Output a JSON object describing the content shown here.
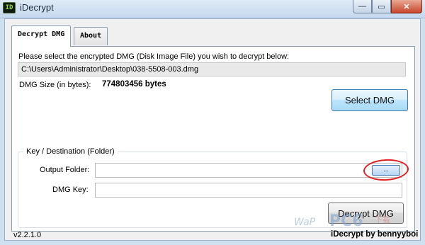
{
  "window": {
    "title": "iDecrypt",
    "icon": "app-icon",
    "icon_glyph": "ID",
    "controls": {
      "minimize": "—",
      "maximize": "▭",
      "close": "✕"
    }
  },
  "tabs": [
    {
      "label": "Decrypt DMG",
      "active": true
    },
    {
      "label": "About",
      "active": false
    }
  ],
  "main": {
    "prompt": "Please select the encrypted DMG (Disk Image File) you wish to decrypt below:",
    "dmg_path": "C:\\Users\\Administrator\\Desktop\\038-5508-003.dmg",
    "size_label": "DMG Size (in bytes):",
    "size_value": "774803456 bytes",
    "select_button": "Select DMG"
  },
  "group": {
    "title": "Key / Destination (Folder)",
    "output_label": "Output Folder:",
    "output_value": "",
    "browse_button": "...",
    "key_label": "DMG Key:",
    "key_value": "",
    "decrypt_button": "Decrypt DMG"
  },
  "watermark": {
    "text1": "WaP",
    "text2": "PC6",
    "text3": "下载"
  },
  "footer": {
    "version": "v2.2.1.0",
    "credit": "iDecrypt by bennyyboi"
  },
  "colors": {
    "annotation_ring": "#e02020",
    "accent_button": "#bee6fd"
  }
}
